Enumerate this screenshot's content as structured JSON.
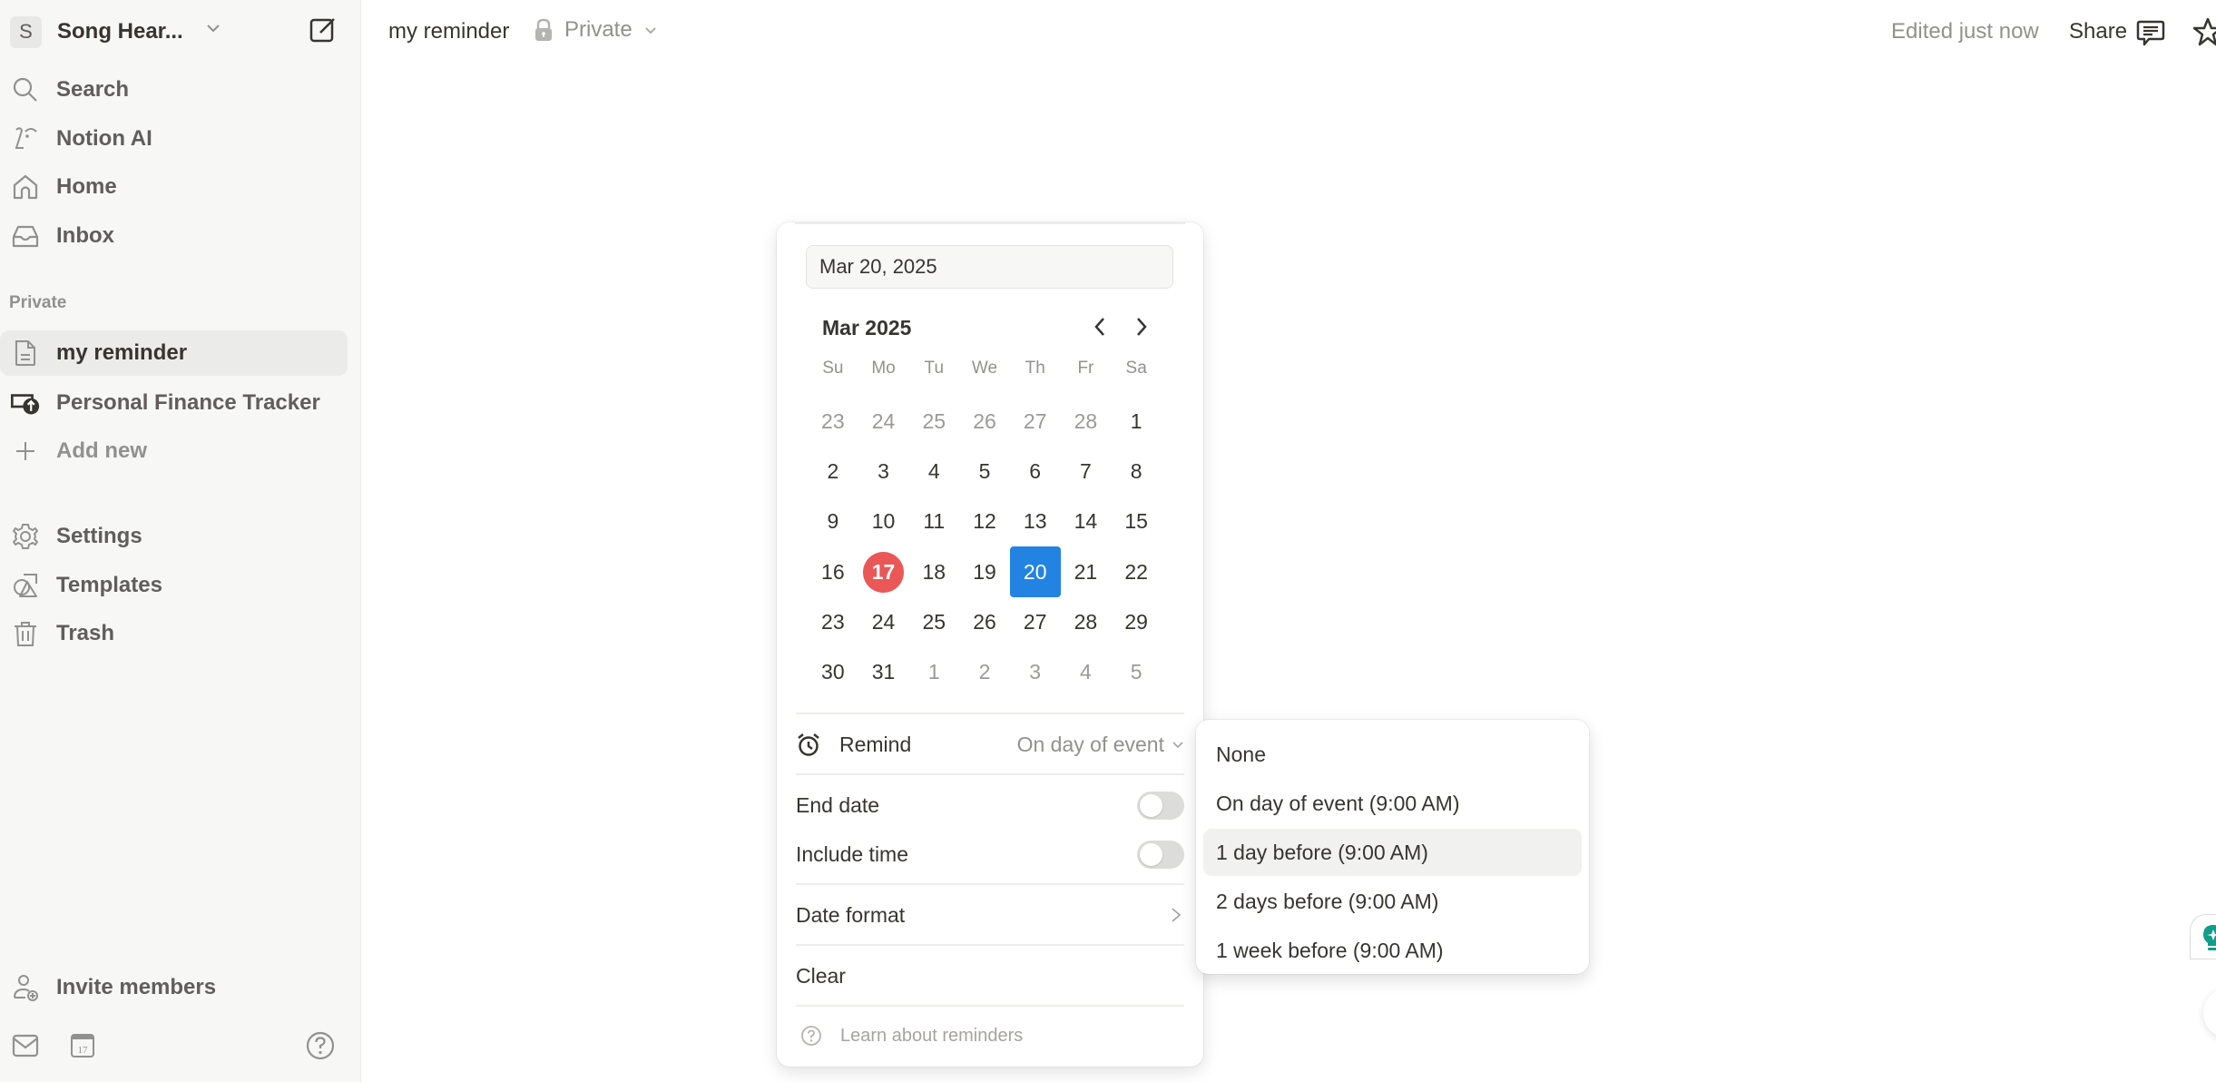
{
  "workspace": {
    "avatar_letter": "S",
    "name": "Song Hear..."
  },
  "sidebar": {
    "nav": [
      {
        "label": "Search",
        "icon": "search-icon"
      },
      {
        "label": "Notion AI",
        "icon": "notion-ai-icon"
      },
      {
        "label": "Home",
        "icon": "home-icon"
      },
      {
        "label": "Inbox",
        "icon": "inbox-icon"
      }
    ],
    "section_label": "Private",
    "pages": [
      {
        "label": "my reminder",
        "icon": "page-icon",
        "active": true
      },
      {
        "label": "Personal Finance Tracker",
        "icon": "finance-icon",
        "active": false
      }
    ],
    "add_new_label": "Add new",
    "utilities": [
      {
        "label": "Settings",
        "icon": "gear-icon"
      },
      {
        "label": "Templates",
        "icon": "templates-icon"
      },
      {
        "label": "Trash",
        "icon": "trash-icon"
      }
    ],
    "invite_label": "Invite members",
    "calendar_icon_day": "17"
  },
  "topbar": {
    "page_title": "my reminder",
    "privacy_label": "Private",
    "edited_status": "Edited just now",
    "share_label": "Share"
  },
  "date_picker": {
    "input_value": "Mar 20, 2025",
    "month_label": "Mar 2025",
    "weekdays": [
      "Su",
      "Mo",
      "Tu",
      "We",
      "Th",
      "Fr",
      "Sa"
    ],
    "weeks": [
      [
        {
          "d": "23",
          "out": true
        },
        {
          "d": "24",
          "out": true
        },
        {
          "d": "25",
          "out": true
        },
        {
          "d": "26",
          "out": true
        },
        {
          "d": "27",
          "out": true
        },
        {
          "d": "28",
          "out": true
        },
        {
          "d": "1"
        }
      ],
      [
        {
          "d": "2"
        },
        {
          "d": "3"
        },
        {
          "d": "4"
        },
        {
          "d": "5"
        },
        {
          "d": "6"
        },
        {
          "d": "7"
        },
        {
          "d": "8"
        }
      ],
      [
        {
          "d": "9"
        },
        {
          "d": "10"
        },
        {
          "d": "11"
        },
        {
          "d": "12"
        },
        {
          "d": "13"
        },
        {
          "d": "14"
        },
        {
          "d": "15"
        }
      ],
      [
        {
          "d": "16"
        },
        {
          "d": "17",
          "today": true
        },
        {
          "d": "18"
        },
        {
          "d": "19"
        },
        {
          "d": "20",
          "selected": true
        },
        {
          "d": "21"
        },
        {
          "d": "22"
        }
      ],
      [
        {
          "d": "23"
        },
        {
          "d": "24"
        },
        {
          "d": "25"
        },
        {
          "d": "26"
        },
        {
          "d": "27"
        },
        {
          "d": "28"
        },
        {
          "d": "29"
        }
      ],
      [
        {
          "d": "30"
        },
        {
          "d": "31"
        },
        {
          "d": "1",
          "out": true
        },
        {
          "d": "2",
          "out": true
        },
        {
          "d": "3",
          "out": true
        },
        {
          "d": "4",
          "out": true
        },
        {
          "d": "5",
          "out": true
        }
      ]
    ],
    "today_color": "#eb5757",
    "selected_color": "#2383e2",
    "remind_label": "Remind",
    "remind_value": "On day of event",
    "end_date_label": "End date",
    "end_date_on": false,
    "include_time_label": "Include time",
    "include_time_on": false,
    "date_format_label": "Date format",
    "clear_label": "Clear",
    "learn_label": "Learn about reminders"
  },
  "remind_dropdown": {
    "options": [
      {
        "label": "None"
      },
      {
        "label": "On day of event (9:00 AM)"
      },
      {
        "label": "1 day before (9:00 AM)",
        "hovered": true
      },
      {
        "label": "2 days before (9:00 AM)"
      },
      {
        "label": "1 week before (9:00 AM)"
      }
    ]
  }
}
